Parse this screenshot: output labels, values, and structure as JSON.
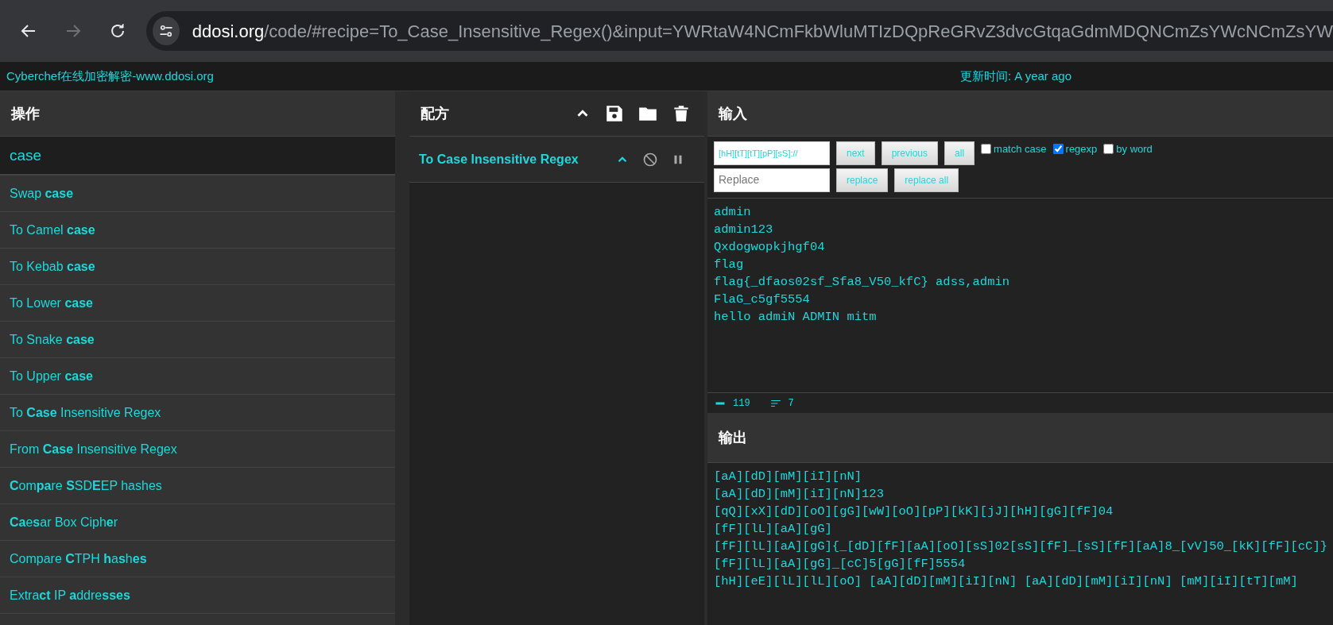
{
  "browser": {
    "url_host": "ddosi.org",
    "url_path": "/code/#recipe=To_Case_Insensitive_Regex()&input=YWRtaW4NCmFkbWluMTIzDQpReGRvZ3dvcGtqaGdmMDQNCmZsYWcNCmZsYW",
    "forward_disabled": true
  },
  "banner": {
    "title": "Cyberchef在线加密解密-www.ddosi.org",
    "updated": "更新时间: A year ago"
  },
  "operations": {
    "title": "操作",
    "search": "case",
    "items": [
      "Swap **case**",
      "To Camel **case**",
      "To Kebab **case**",
      "To Lower **case**",
      "To Snake **case**",
      "To Upper **case**",
      "To **Case** Insensitive Regex",
      "From **Case** Insensitive Regex",
      "**C**om**pa**re **S**SD**E**EP hashes",
      "**Ca**e**s**ar Box Ciph**e**r",
      "Compare **C**TPH **h**a**s**h**es**",
      "Extra**ct** IP **a**ddre**sses**"
    ]
  },
  "recipe": {
    "title": "配方",
    "items": [
      {
        "name": "To Case Insensitive Regex",
        "disabled": false
      }
    ]
  },
  "input": {
    "title": "输入",
    "find": {
      "value": "[hH][tT][tT][pP][sS]://"
    },
    "find_buttons": [
      "next",
      "previous",
      "all"
    ],
    "options": [
      {
        "label": "match case",
        "checked": false
      },
      {
        "label": "regexp",
        "checked": true
      },
      {
        "label": "by word",
        "checked": false
      }
    ],
    "replace": {
      "placeholder": "Replace"
    },
    "replace_buttons": [
      "replace",
      "replace all"
    ],
    "lines": [
      "admin",
      "admin123",
      "Qxdogwopkjhgf04",
      "flag",
      "flag{_dfaos02sf_Sfa8_V50_kfC} adss,admin",
      "FlaG_c5gf5554",
      "hello admiN ADMIN mitm"
    ],
    "status": {
      "chars": "119",
      "lines": "7"
    }
  },
  "output": {
    "title": "输出",
    "lines": [
      "[aA][dD][mM][iI][nN]",
      "[aA][dD][mM][iI][nN]123",
      "[qQ][xX][dD][oO][gG][wW][oO][pP][kK][jJ][hH][gG][fF]04",
      "[fF][lL][aA][gG]",
      "[fF][lL][aA][gG]{_[dD][fF][aA][oO][sS]02[sS][fF]_[sS][fF][aA]8_[vV]50_[kK][fF][cC]}",
      "[fF][lL][aA][gG]_[cC]5[gG][fF]5554",
      "[hH][eE][lL][lL][oO] [aA][dD][mM][iI][nN] [aA][dD][mM][iI][nN] [mM][iI][tT][mM]"
    ]
  }
}
